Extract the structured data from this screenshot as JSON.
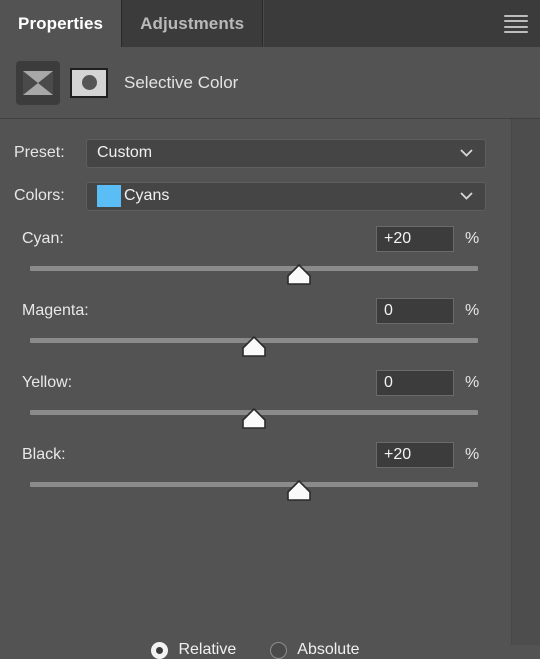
{
  "tabs": [
    {
      "label": "Properties",
      "active": true
    },
    {
      "label": "Adjustments",
      "active": false
    }
  ],
  "menu": {
    "icon": "hamburger-menu-icon"
  },
  "adjustment": {
    "title": "Selective Color",
    "layer_icon": "selective-color-icon",
    "mask_icon": "layer-mask-thumbnail"
  },
  "preset": {
    "label": "Preset:",
    "value": "Custom",
    "chevron": "chevron-down-icon"
  },
  "colors": {
    "label": "Colors:",
    "value": "Cyans",
    "swatch_color": "#5bbdf5",
    "chevron": "chevron-down-icon"
  },
  "sliders": [
    {
      "label": "Cyan:",
      "value": "+20",
      "unit": "%",
      "number": 20,
      "min": -100,
      "max": 100
    },
    {
      "label": "Magenta:",
      "value": "0",
      "unit": "%",
      "number": 0,
      "min": -100,
      "max": 100
    },
    {
      "label": "Yellow:",
      "value": "0",
      "unit": "%",
      "number": 0,
      "min": -100,
      "max": 100
    },
    {
      "label": "Black:",
      "value": "+20",
      "unit": "%",
      "number": 20,
      "min": -100,
      "max": 100
    }
  ],
  "method": {
    "options": [
      {
        "label": "Relative",
        "selected": true
      },
      {
        "label": "Absolute",
        "selected": false
      }
    ]
  },
  "theme": {
    "panel_bg": "#535353",
    "tabbar_bg": "#2f2f2f",
    "active_tab_bg": "#535353",
    "inactive_tab_bg": "#3b3b3b",
    "text": "#e8e8e8",
    "track": "#8b8b8b",
    "field_bg": "#3c3c3c"
  }
}
